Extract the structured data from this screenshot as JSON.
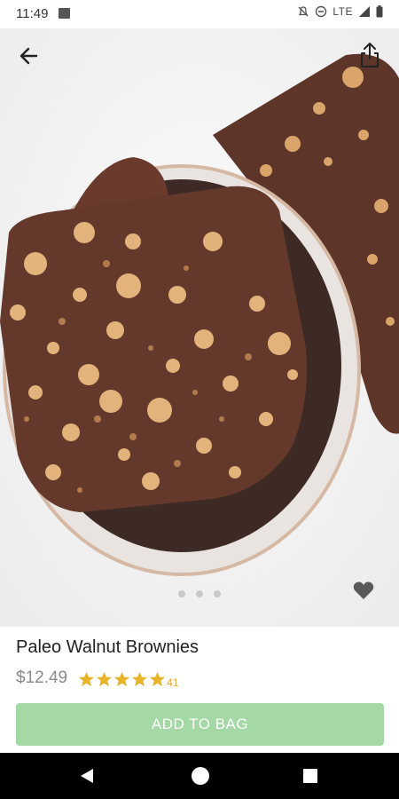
{
  "status_bar": {
    "time": "11:49",
    "network": "LTE",
    "icons": [
      "gallery-icon",
      "mute-icon",
      "do-not-disturb-icon",
      "signal-icon",
      "battery-icon"
    ]
  },
  "toolbar": {
    "back_icon": "arrow-left-icon",
    "share_icon": "share-icon"
  },
  "gallery": {
    "image": "paleo walnut brownies in a bowl",
    "dot_count": 3,
    "active_dot": 1,
    "favorite_icon": "heart-icon"
  },
  "product": {
    "name": "Paleo Walnut Brownies",
    "price": "$12.49",
    "rating_stars": 5,
    "review_count": "41",
    "star_color": "#e6b32b"
  },
  "cta": {
    "add_to_bag_label": "ADD TO BAG",
    "color": "#a4d8a4"
  },
  "nav_bar": {
    "icons": [
      "nav-back-icon",
      "nav-home-icon",
      "nav-recent-icon"
    ]
  }
}
